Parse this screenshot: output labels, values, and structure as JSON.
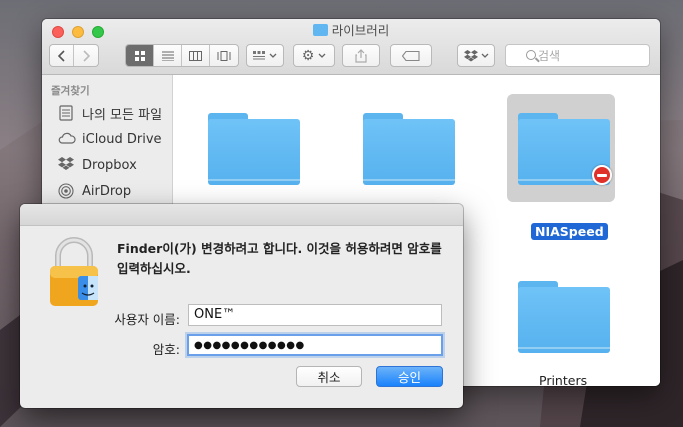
{
  "window": {
    "title": "라이브러리"
  },
  "toolbar": {
    "view_modes": [
      "icon-view",
      "list-view",
      "column-view",
      "coverflow-view"
    ],
    "active_view": "icon-view",
    "search_placeholder": "검색"
  },
  "sidebar": {
    "section_title": "즐겨찾기",
    "items": [
      {
        "label": "나의 모든 파일",
        "icon": "all-files-icon"
      },
      {
        "label": "iCloud Drive",
        "icon": "cloud-icon"
      },
      {
        "label": "Dropbox",
        "icon": "dropbox-icon"
      },
      {
        "label": "AirDrop",
        "icon": "airdrop-icon"
      }
    ]
  },
  "content": {
    "items": [
      {
        "name": "",
        "type": "folder"
      },
      {
        "name": "",
        "type": "folder"
      },
      {
        "name": "NIASpeed",
        "type": "folder",
        "selected": true,
        "badge": "no-entry"
      },
      {
        "name": "Printers",
        "type": "folder"
      }
    ]
  },
  "dialog": {
    "message": "Finder이(가) 변경하려고 합니다. 이것을 허용하려면 암호를 입력하십시오.",
    "username_label": "사용자 이름:",
    "username_value": "ONE™",
    "password_label": "암호:",
    "password_value": "●●●●●●●●●●●●",
    "cancel_label": "취소",
    "ok_label": "승인"
  },
  "colors": {
    "accent": "#1a82fb",
    "folder": "#5fb6f0",
    "selection": "#1f68d6"
  }
}
